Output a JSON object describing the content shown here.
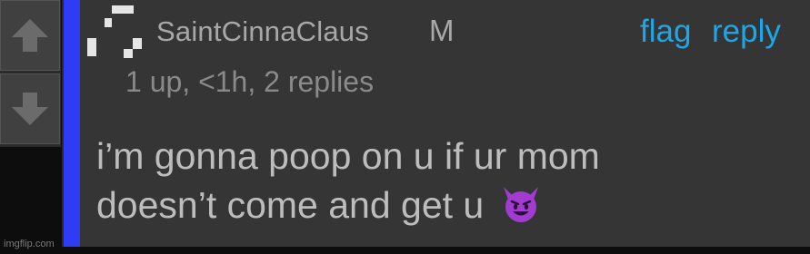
{
  "vote": {
    "up_icon": "arrow-up-icon",
    "down_icon": "arrow-down-icon"
  },
  "comment": {
    "avatar_icon": "pixel-avatar-icon",
    "username": "SaintCinnaClaus",
    "gender": "M",
    "actions": {
      "flag": "flag",
      "reply": "reply"
    },
    "meta": "1 up, <1h, 2 replies",
    "body_line1": "i’m gonna poop on u if ur mom",
    "body_line2": "doesn’t come and get u",
    "emoji_icon": "smiling-devil-emoji"
  },
  "watermark": "imgflip.com",
  "colors": {
    "accent_bar": "#2f3cf5",
    "link": "#1ea7e8",
    "panel": "#353535",
    "emoji": "#a23bd0"
  }
}
